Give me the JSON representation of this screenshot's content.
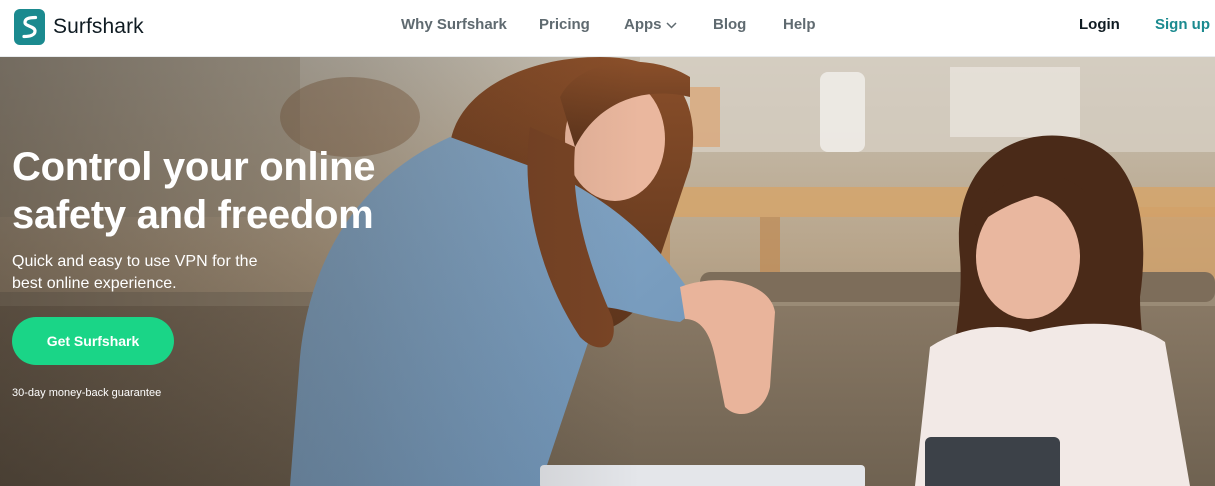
{
  "brand": {
    "name": "Surfshark",
    "logo_icon": "surfshark-s-logo-icon",
    "color": "#1b8a8f"
  },
  "nav": {
    "items": [
      {
        "label": "Why Surfshark"
      },
      {
        "label": "Pricing"
      },
      {
        "label": "Apps",
        "icon": "chevron-down-icon"
      },
      {
        "label": "Blog"
      },
      {
        "label": "Help"
      }
    ],
    "login": "Login",
    "signup": "Sign up"
  },
  "hero": {
    "title": "Control your online safety and freedom",
    "subtitle": "Quick and easy to use VPN for the best online experience.",
    "cta": "Get Surfshark",
    "guarantee": "30-day money-back guarantee",
    "cta_color": "#1ad587"
  }
}
